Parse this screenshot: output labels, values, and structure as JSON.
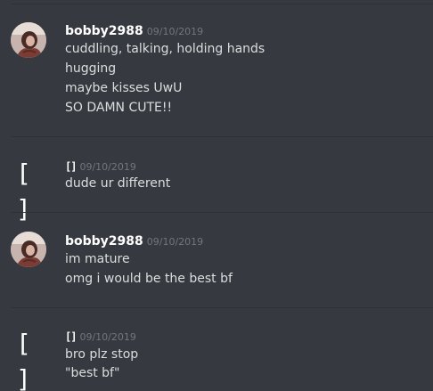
{
  "messages": [
    {
      "username": "bobby2988",
      "timestamp": "09/10/2019",
      "lines": [
        "cuddling, talking, holding hands",
        "hugging",
        "maybe kisses UwU",
        "SO DAMN CUTE!!"
      ]
    },
    {
      "username": "[]",
      "avatar_text": "[ ]",
      "timestamp": "09/10/2019",
      "lines": [
        "dude ur different"
      ]
    },
    {
      "username": "bobby2988",
      "timestamp": "09/10/2019",
      "lines": [
        "im mature",
        "omg i would be the best bf"
      ]
    },
    {
      "username": "[]",
      "avatar_text": "[ ]",
      "timestamp": "09/10/2019",
      "lines": [
        "bro plz stop",
        "\"best bf\""
      ]
    }
  ],
  "colors": {
    "background": "#36393f",
    "username": "#ffffff",
    "timestamp": "#72767d",
    "text": "#dcddde"
  }
}
